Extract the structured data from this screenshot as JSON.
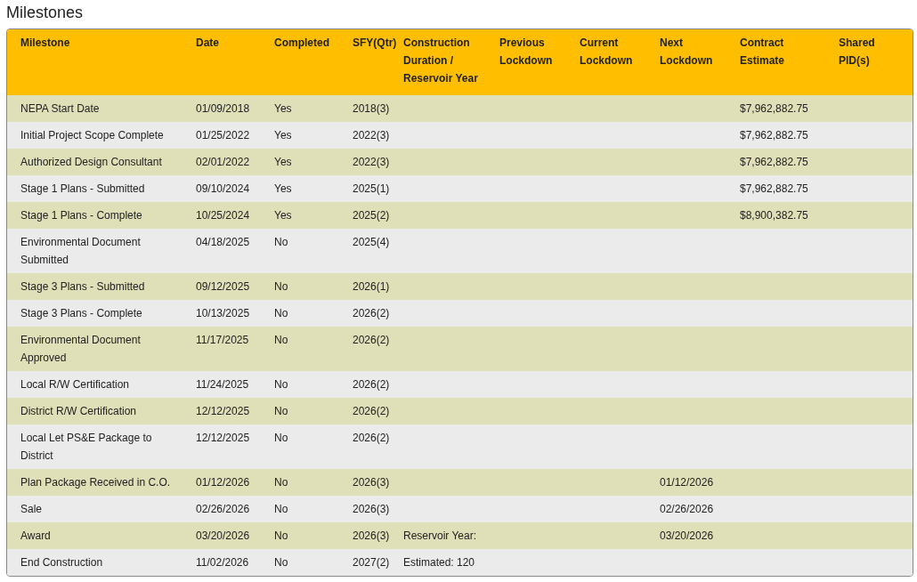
{
  "title": "Milestones",
  "table": {
    "columns": [
      "Milestone",
      "Date",
      "Completed",
      "SFY(Qtr)",
      "Construction Duration / Reservoir Year",
      "Previous Lockdown",
      "Current Lockdown",
      "Next Lockdown",
      "Contract Estimate",
      "Shared PID(s)"
    ],
    "rows": [
      {
        "milestone": "NEPA Start Date",
        "date": "01/09/2018",
        "completed": "Yes",
        "sfy_qtr": "2018(3)",
        "contract_estimate": "$7,962,882.75"
      },
      {
        "milestone": "Initial Project Scope Complete",
        "date": "01/25/2022",
        "completed": "Yes",
        "sfy_qtr": "2022(3)",
        "contract_estimate": "$7,962,882.75"
      },
      {
        "milestone": "Authorized Design Consultant",
        "date": "02/01/2022",
        "completed": "Yes",
        "sfy_qtr": "2022(3)",
        "contract_estimate": "$7,962,882.75"
      },
      {
        "milestone": "Stage 1 Plans - Submitted",
        "date": "09/10/2024",
        "completed": "Yes",
        "sfy_qtr": "2025(1)",
        "contract_estimate": "$7,962,882.75"
      },
      {
        "milestone": "Stage 1 Plans - Complete",
        "date": "10/25/2024",
        "completed": "Yes",
        "sfy_qtr": "2025(2)",
        "contract_estimate": "$8,900,382.75"
      },
      {
        "milestone": "Environmental Document Submitted",
        "date": "04/18/2025",
        "completed": "No",
        "sfy_qtr": "2025(4)"
      },
      {
        "milestone": "Stage 3 Plans - Submitted",
        "date": "09/12/2025",
        "completed": "No",
        "sfy_qtr": "2026(1)"
      },
      {
        "milestone": "Stage 3 Plans - Complete",
        "date": "10/13/2025",
        "completed": "No",
        "sfy_qtr": "2026(2)"
      },
      {
        "milestone": "Environmental Document Approved",
        "date": "11/17/2025",
        "completed": "No",
        "sfy_qtr": "2026(2)"
      },
      {
        "milestone": "Local R/W Certification",
        "date": "11/24/2025",
        "completed": "No",
        "sfy_qtr": "2026(2)"
      },
      {
        "milestone": "District R/W Certification",
        "date": "12/12/2025",
        "completed": "No",
        "sfy_qtr": "2026(2)"
      },
      {
        "milestone": "Local Let PS&E Package to District",
        "date": "12/12/2025",
        "completed": "No",
        "sfy_qtr": "2026(2)"
      },
      {
        "milestone": "Plan Package Received in C.O.",
        "date": "01/12/2026",
        "completed": "No",
        "sfy_qtr": "2026(3)",
        "next_lockdown": "01/12/2026"
      },
      {
        "milestone": "Sale",
        "date": "02/26/2026",
        "completed": "No",
        "sfy_qtr": "2026(3)",
        "next_lockdown": "02/26/2026"
      },
      {
        "milestone": "Award",
        "date": "03/20/2026",
        "completed": "No",
        "sfy_qtr": "2026(3)",
        "construction_duration": "Reservoir Year:",
        "next_lockdown": "03/20/2026"
      },
      {
        "milestone": "End Construction",
        "date": "11/02/2026",
        "completed": "No",
        "sfy_qtr": "2027(2)",
        "construction_duration": "Estimated: 120"
      }
    ]
  }
}
